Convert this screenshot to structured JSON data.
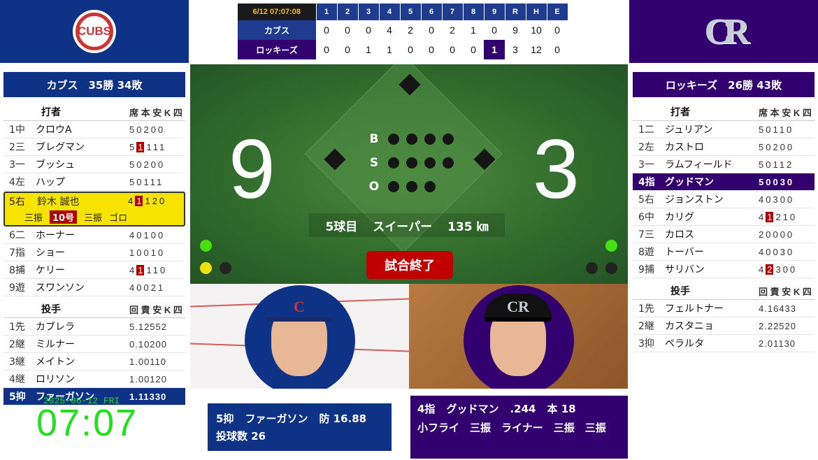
{
  "linescore": {
    "time": "6/12 07:07:08",
    "innings": [
      "1",
      "2",
      "3",
      "4",
      "5",
      "6",
      "7",
      "8",
      "9",
      "R",
      "H",
      "E"
    ],
    "away": {
      "name": "カブス",
      "scores": [
        "0",
        "0",
        "0",
        "4",
        "2",
        "0",
        "2",
        "1",
        "0",
        "9",
        "10",
        "0"
      ]
    },
    "home": {
      "name": "ロッキーズ",
      "scores": [
        "0",
        "0",
        "1",
        "1",
        "0",
        "0",
        "0",
        "0",
        "1",
        "3",
        "12",
        "0"
      ]
    }
  },
  "cubs": {
    "header": "カブス　35勝 34敗",
    "batting_head": {
      "title": "打者",
      "cols": "席 本 安 K 四"
    },
    "batters": [
      {
        "pos": "1中",
        "name": "クロウA",
        "stats": "50200"
      },
      {
        "pos": "2三",
        "name": "ブレグマン",
        "pre": "5",
        "hr": "1",
        "post": "111"
      },
      {
        "pos": "3一",
        "name": "ブッシュ",
        "stats": "50200"
      },
      {
        "pos": "4左",
        "name": "ハップ",
        "stats": "50111"
      }
    ],
    "current": {
      "pos": "5右",
      "name": "鈴木 誠也",
      "pre": "4",
      "hr": "1",
      "post": "120",
      "res1": "三振",
      "badge": "10号",
      "res2": "三振",
      "res3": "ゴロ"
    },
    "batters2": [
      {
        "pos": "6二",
        "name": "ホーナー",
        "stats": "40100"
      },
      {
        "pos": "7指",
        "name": "ショー",
        "stats": "10010"
      },
      {
        "pos": "8捕",
        "name": "ケリー",
        "pre": "4",
        "hr": "1",
        "post": "110"
      },
      {
        "pos": "9遊",
        "name": "スワンソン",
        "stats": "40021"
      }
    ],
    "pitching_head": {
      "title": "投手",
      "cols": "回 責 安 K 四"
    },
    "pitchers": [
      {
        "pos": "1先",
        "name": "カブレラ",
        "stats": "5.12552"
      },
      {
        "pos": "2継",
        "name": "ミルナー",
        "stats": "0.10200"
      },
      {
        "pos": "3継",
        "name": "メイトン",
        "stats": "1.00110"
      },
      {
        "pos": "4継",
        "name": "ロリソン",
        "stats": "1.00120"
      },
      {
        "pos": "5抑",
        "name": "ファーガソン",
        "stats": "1.11330"
      }
    ]
  },
  "rockies": {
    "header": "ロッキーズ　26勝 43敗",
    "batting_head": {
      "title": "打者",
      "cols": "席 本 安 K 四"
    },
    "batters": [
      {
        "pos": "1二",
        "name": "ジュリアン",
        "stats": "50110"
      },
      {
        "pos": "2左",
        "name": "カストロ",
        "stats": "50200"
      },
      {
        "pos": "3一",
        "name": "ラムフィールド",
        "stats": "50112"
      },
      {
        "pos": "4指",
        "name": "グッドマン",
        "stats": "50030"
      },
      {
        "pos": "5右",
        "name": "ジョンストン",
        "stats": "40300"
      },
      {
        "pos": "6中",
        "name": "カリグ",
        "pre": "4",
        "hr": "1",
        "post": "210"
      },
      {
        "pos": "7三",
        "name": "カロス",
        "stats": "20000"
      },
      {
        "pos": "8遊",
        "name": "トーバー",
        "stats": "40030"
      },
      {
        "pos": "9捕",
        "name": "サリバン",
        "pre": "4",
        "hr": "2",
        "post": "300"
      }
    ],
    "pitching_head": {
      "title": "投手",
      "cols": "回 責 安 K 四"
    },
    "pitchers": [
      {
        "pos": "1先",
        "name": "フェルトナー",
        "stats": "4.16433"
      },
      {
        "pos": "2継",
        "name": "カスタニョ",
        "stats": "2.22520"
      },
      {
        "pos": "3抑",
        "name": "ペラルタ",
        "stats": "2.01130"
      }
    ]
  },
  "field": {
    "away_score": "9",
    "home_score": "3",
    "b_label": "B",
    "s_label": "S",
    "o_label": "O",
    "pitch_no": "5球目",
    "pitch_type": "スイーパー",
    "speed": "135 ㎞",
    "game_over": "試合終了"
  },
  "logos": {
    "cubs": "CUBS",
    "rockies": "CR"
  },
  "pitcher_box": {
    "line1_pos": "5抑",
    "line1_name": "ファーガソン",
    "line1_era": "防 16.88",
    "line2": "投球数 26"
  },
  "batter_box": {
    "pos": "4指",
    "name": "グッドマン",
    "avg": ".244",
    "hr": "本 18",
    "results": "小フライ　三振　ライナー　三振　三振"
  },
  "clock": {
    "date": "2025-06-12 FRI",
    "time": "07:07"
  },
  "colors": {
    "cubs_blue": "#0e3386",
    "rockies_purple": "#33006f",
    "hr_red": "#b00000",
    "highlight_yellow": "#f7e300"
  }
}
